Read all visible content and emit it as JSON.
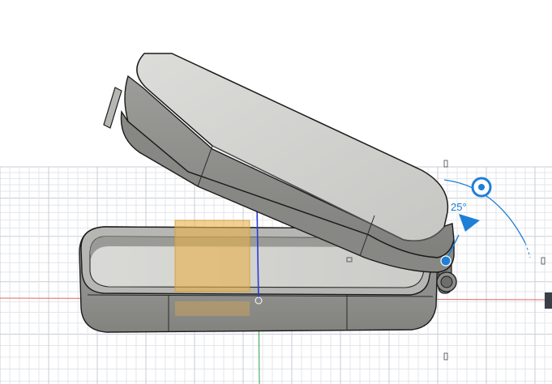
{
  "viewport": {
    "grid_visible": true,
    "colors": {
      "background": "#ffffff",
      "grid_minor": "#e3e6ea",
      "grid_major": "#c9ced4",
      "axis_x": "#e06666",
      "axis_y": "#2ea043",
      "axis_z": "#2b3bd6",
      "accent": "#1f7fd6",
      "section_plane": "#e8b04a",
      "body_fill": "#cfcfcd",
      "body_shade": "#8e8f8c",
      "edge": "#1b1b1b"
    }
  },
  "model": {
    "base": "hinged-case-base",
    "lid": "hinged-case-lid"
  },
  "rotate_manipulator": {
    "angle_label": "25°",
    "angle_value": 25
  },
  "icons": {
    "rotate_handle": "rotate-handle-icon",
    "direction_arrow": "direction-arrow-icon",
    "pivot_point": "pivot-point-icon",
    "origin_point": "origin-point-icon"
  }
}
